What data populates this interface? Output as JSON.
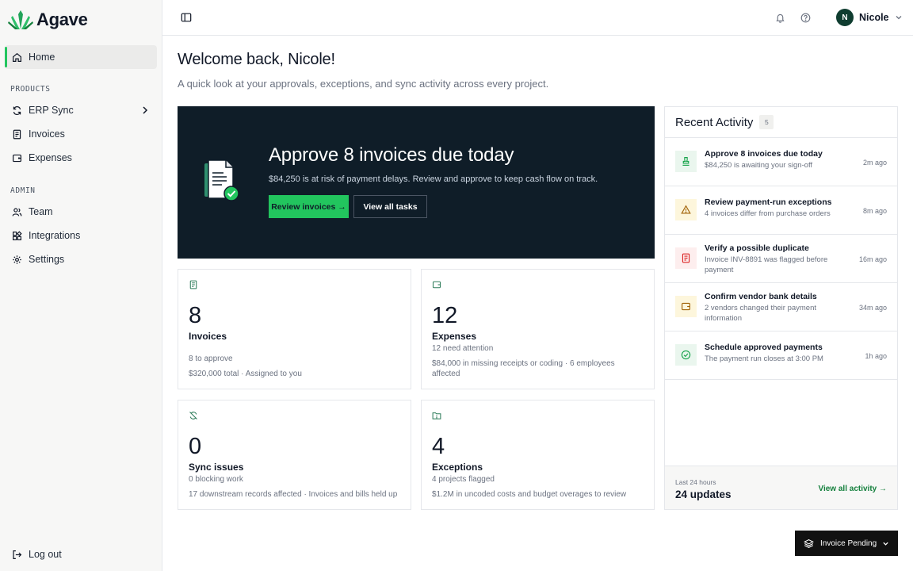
{
  "app": {
    "name": "Agave"
  },
  "sidebar": {
    "home": "Home",
    "products_label": "PRODUCTS",
    "products": [
      "ERP Sync",
      "Invoices",
      "Expenses"
    ],
    "admin_label": "ADMIN",
    "admin": [
      "Team",
      "Integrations",
      "Settings"
    ],
    "logout": "Log out"
  },
  "header": {
    "user": {
      "initial": "N",
      "name": "Nicole"
    }
  },
  "page": {
    "title": "Welcome back, Nicole!",
    "subtitle": "A quick look at your approvals, exceptions, and sync activity across every project."
  },
  "hero": {
    "title": "Approve 8 invoices due today",
    "subtitle": "$84,250 is at risk of payment delays. Review and approve to keep cash flow on track.",
    "primary": "Review invoices →",
    "secondary": "View all tasks"
  },
  "stats": [
    {
      "value": "8",
      "label": "Invoices",
      "line1": "8 to approve",
      "line2": "$320,000 total · Assigned to you"
    },
    {
      "value": "12",
      "label": "Expenses",
      "line1": "12 need attention",
      "line2": "$84,000 in missing receipts or coding · 6 employees affected"
    },
    {
      "value": "0",
      "label": "Sync issues",
      "line1": "0 blocking work",
      "line2": "17 downstream records affected · Invoices and bills held up"
    },
    {
      "value": "4",
      "label": "Exceptions",
      "line1": "4 projects flagged",
      "line2": "$1.2M in uncoded costs and budget overages to review"
    }
  ],
  "activity": {
    "title": "Recent Activity",
    "count": "5",
    "items": [
      {
        "title": "Approve 8 invoices due today",
        "sub": "$84,250 is awaiting your sign-off",
        "time": "2m ago",
        "icon": "stamp-icon",
        "color": "#16a34a",
        "bg": "#eaf6ee"
      },
      {
        "title": "Review payment-run exceptions",
        "sub": "4 invoices differ from purchase orders",
        "time": "8m ago",
        "icon": "warning-icon",
        "color": "#a16207",
        "bg": "#fdf6dc"
      },
      {
        "title": "Verify a possible duplicate",
        "sub": "Invoice INV-8891 was flagged before payment",
        "time": "16m ago",
        "icon": "document-icon",
        "color": "#dc2626",
        "bg": "#fdeeee"
      },
      {
        "title": "Confirm vendor bank details",
        "sub": "2 vendors changed their payment information",
        "time": "34m ago",
        "icon": "wallet-icon",
        "color": "#a16207",
        "bg": "#fdf6dc"
      },
      {
        "title": "Schedule approved payments",
        "sub": "The payment run closes at 3:00 PM",
        "time": "1h ago",
        "icon": "check-circle-icon",
        "color": "#16a34a",
        "bg": "#eaf6ee"
      }
    ],
    "footer": {
      "label": "Last 24 hours",
      "value": "24 updates",
      "link": "View all activity →"
    }
  },
  "status": {
    "label": "Invoice Pending"
  }
}
